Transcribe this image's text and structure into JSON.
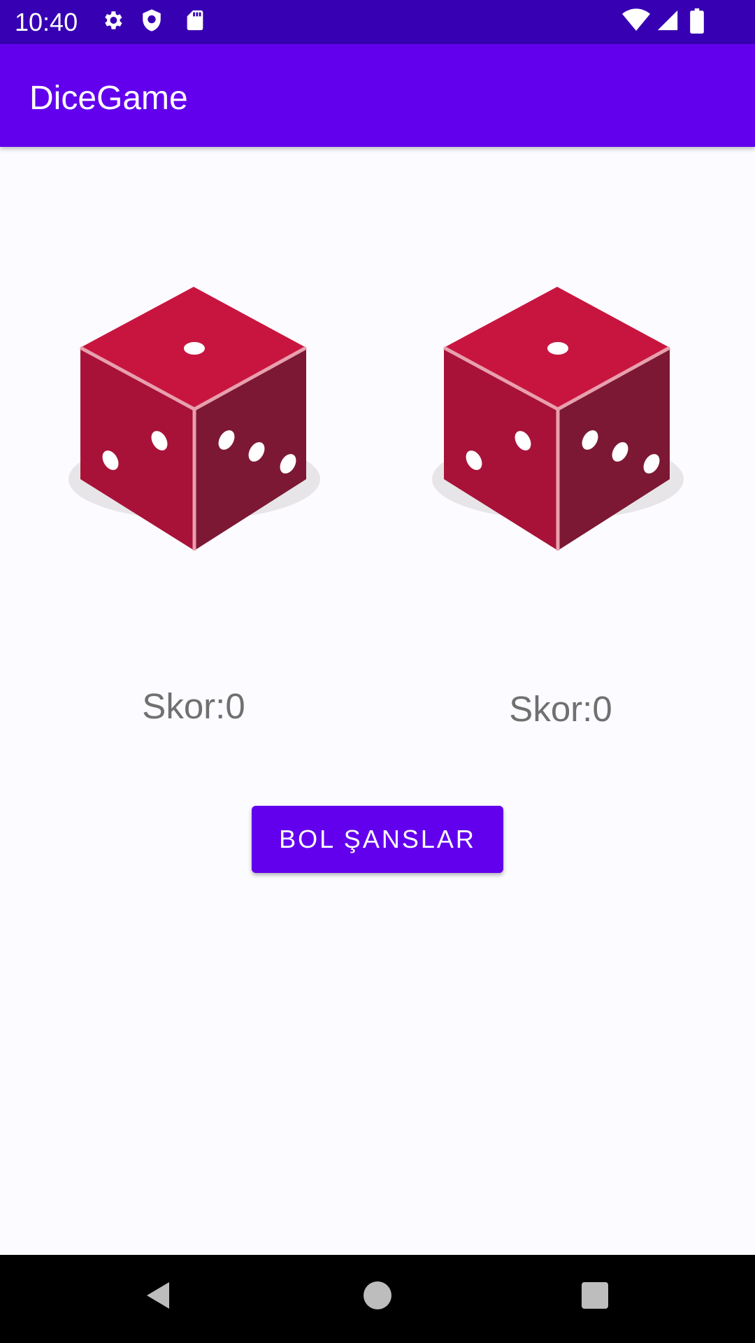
{
  "status_bar": {
    "time": "10:40",
    "left_icons": [
      "gear-icon",
      "shield-icon",
      "sd-card-icon"
    ],
    "right_icons": [
      "wifi-icon",
      "signal-icon",
      "battery-icon"
    ]
  },
  "app_bar": {
    "title": "DiceGame"
  },
  "dice": [
    {
      "top_face": 1,
      "left_face": 2,
      "right_face": 3
    },
    {
      "top_face": 1,
      "left_face": 2,
      "right_face": 3
    }
  ],
  "scores": {
    "player1": "Skor:0",
    "player2": "Skor:0"
  },
  "roll_button": {
    "label": "BOL ŞANSLAR"
  },
  "nav_bar": {
    "buttons": [
      "back-icon",
      "home-icon",
      "recents-icon"
    ]
  },
  "colors": {
    "status_bar": "#3700b3",
    "app_bar": "#6200ee",
    "accent": "#6200ee",
    "die_top": "#c8153f",
    "die_left": "#a81238",
    "die_right": "#7c1834"
  }
}
